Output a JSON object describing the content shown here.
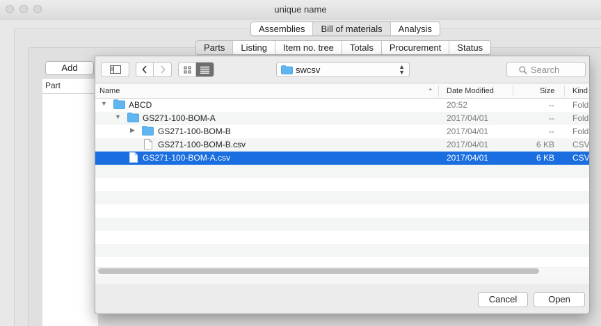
{
  "window": {
    "title": "unique name"
  },
  "main_tabs": [
    {
      "label": "Assemblies",
      "active": false
    },
    {
      "label": "Bill of materials",
      "active": true
    },
    {
      "label": "Analysis",
      "active": false
    }
  ],
  "sub_tabs": [
    {
      "label": "Parts",
      "active": true
    },
    {
      "label": "Listing",
      "active": false
    },
    {
      "label": "Item no. tree",
      "active": false
    },
    {
      "label": "Totals",
      "active": false
    },
    {
      "label": "Procurement",
      "active": false
    },
    {
      "label": "Status",
      "active": false
    }
  ],
  "main": {
    "add_label": "Add",
    "table_header": "Part"
  },
  "dialog": {
    "location": "swcsv",
    "search_placeholder": "Search",
    "columns": {
      "name": "Name",
      "date": "Date Modified",
      "size": "Size",
      "kind": "Kind"
    },
    "rows": [
      {
        "name": "ABCD",
        "date": "20:52",
        "size": "--",
        "kind": "Fold",
        "type": "folder",
        "expanded": true,
        "depth": 0,
        "selected": false
      },
      {
        "name": "GS271-100-BOM-A",
        "date": "2017/04/01",
        "size": "--",
        "kind": "Fold",
        "type": "folder",
        "expanded": true,
        "depth": 1,
        "selected": false
      },
      {
        "name": "GS271-100-BOM-B",
        "date": "2017/04/01",
        "size": "--",
        "kind": "Fold",
        "type": "folder",
        "expanded": false,
        "depth": 2,
        "selected": false
      },
      {
        "name": "GS271-100-BOM-B.csv",
        "date": "2017/04/01",
        "size": "6 KB",
        "kind": "CSV",
        "type": "file",
        "depth": 2,
        "selected": false
      },
      {
        "name": "GS271-100-BOM-A.csv",
        "date": "2017/04/01",
        "size": "6 KB",
        "kind": "CSV",
        "type": "file",
        "depth": 1,
        "selected": true
      }
    ],
    "cancel_label": "Cancel",
    "open_label": "Open"
  },
  "colors": {
    "selection": "#1a6ee0",
    "folder": "#5fb6f0"
  }
}
